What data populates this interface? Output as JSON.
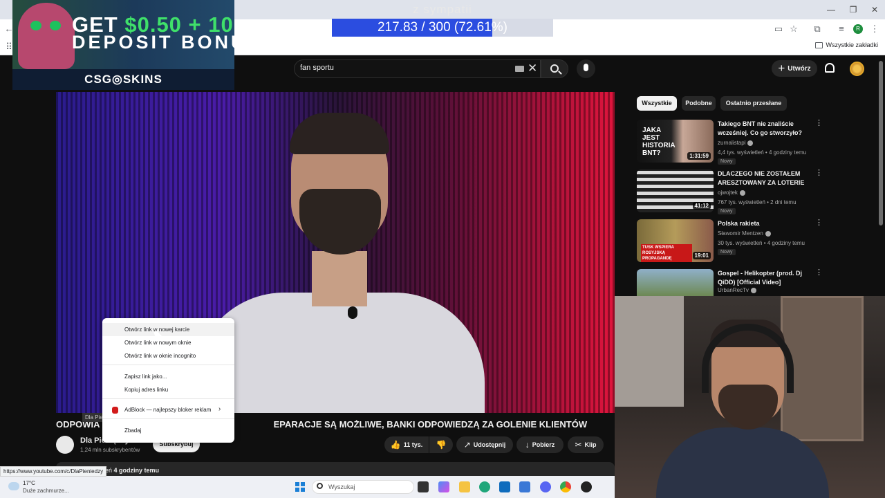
{
  "overlay": {
    "subtitle": "z sympatii",
    "progress_text": "217.83 / 300 (72.61%)",
    "progress_fraction": 0.7261
  },
  "ad": {
    "line1_a": "GET ",
    "line1_b": "$0.50",
    "line1_c": " + 10",
    "line2": "DEPOSIT BONU",
    "brand": "CSG◎SKINS"
  },
  "browser": {
    "bookmarks_all": "Wszystkie zakładki",
    "profile_initial": "R"
  },
  "header": {
    "search_value": "fan sportu",
    "create_label": "Utwórz"
  },
  "video": {
    "title_left": "ODPOWIA",
    "title_right": "EPARACJE SĄ MOŻLIWE, BANKI ODPOWIEDZĄ ZA GOLENIE KLIENTÓW",
    "channel_name": "Dla Pieniędzy",
    "channel_subs": "1,24 mln subskrybentów",
    "subscribe_label": "Subskrybuj",
    "tooltip": "Dla Pie",
    "likes": "11 tys.",
    "share_label": "Udostępnij",
    "download_label": "Pobierz",
    "clip_label": "Klip",
    "desc_prefix": "leń",
    "desc_time": "4 godziny temu"
  },
  "context_menu": {
    "items": [
      "Otwórz link w nowej karcie",
      "Otwórz link w nowym oknie",
      "Otwórz link w oknie incognito",
      "Zapisz link jako...",
      "Kopiuj adres linku",
      "AdBlock — najlepszy bloker reklam",
      "Zbadaj"
    ]
  },
  "sidebar": {
    "chips": [
      "Wszystkie",
      "Podobne",
      "Ostatnio przesłane"
    ],
    "videos": [
      {
        "title": "Takiego BNT nie znaliście wcześniej. Co go stworzyło?",
        "channel": "zurnalistapl",
        "meta": "4,4 tys. wyświetleń • 4 godziny temu",
        "badge": "Nowy",
        "duration": "1:31:59",
        "thumb_text": "JAKA JEST HISTORIA BNT?"
      },
      {
        "title": "DLACZEGO NIE ZOSTAŁEM ARESZTOWANY ZA LOTERIE",
        "channel": "ojwojtek",
        "meta": "767 tys. wyświetleń • 2 dni temu",
        "badge": "Nowy",
        "duration": "41:12",
        "thumb_text": ""
      },
      {
        "title": "Polska rakieta",
        "channel": "Sławomir Mentzen",
        "meta": "30 tys. wyświetleń • 4 godziny temu",
        "badge": "Nowy",
        "duration": "19:01",
        "thumb_text": "TUSK WSPIERA ROSYJSKĄ PROPAGANDĘ"
      },
      {
        "title": "Gospel - Helikopter (prod. Dj QiDD) [Official Video]",
        "channel": "UrbanRecTv",
        "meta": "",
        "badge": "",
        "duration": "",
        "thumb_text": ""
      }
    ]
  },
  "status_url": "https://www.youtube.com/c/DlaPieniedzy",
  "taskbar": {
    "temperature": "17°C",
    "weather": "Duże zachmurze...",
    "search_placeholder": "Wyszukaj"
  },
  "colors": {
    "progress_fill": "#2b4de0",
    "ad_green": "#3fe06a",
    "adblock_red": "#d21b1b"
  }
}
